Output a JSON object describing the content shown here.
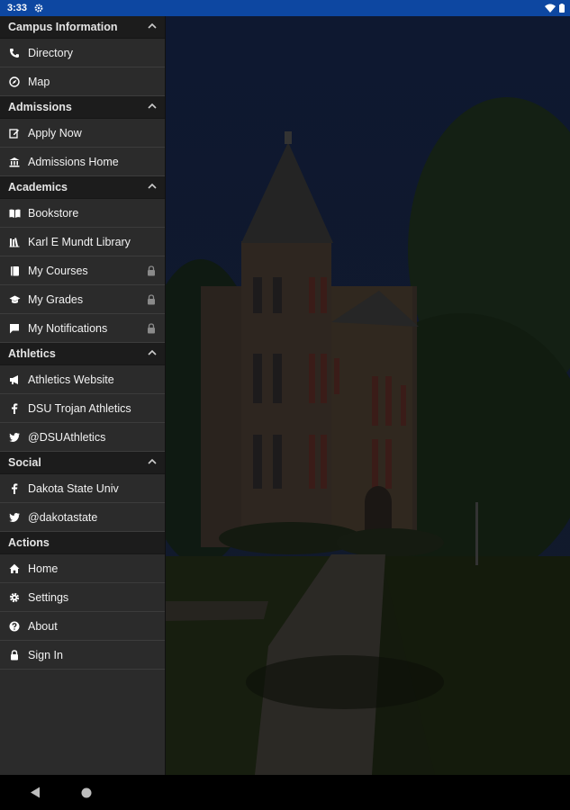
{
  "status_bar": {
    "time": "3:33"
  },
  "drawer": {
    "sections": [
      {
        "title": "Campus Information",
        "collapsible": true,
        "items": [
          {
            "label": "Directory",
            "icon": "phone-icon",
            "locked": false
          },
          {
            "label": "Map",
            "icon": "compass-icon",
            "locked": false
          }
        ]
      },
      {
        "title": "Admissions",
        "collapsible": true,
        "items": [
          {
            "label": "Apply Now",
            "icon": "edit-icon",
            "locked": false
          },
          {
            "label": "Admissions Home",
            "icon": "institution-icon",
            "locked": false
          }
        ]
      },
      {
        "title": "Academics",
        "collapsible": true,
        "items": [
          {
            "label": "Bookstore",
            "icon": "open-book-icon",
            "locked": false
          },
          {
            "label": "Karl E Mundt Library",
            "icon": "library-icon",
            "locked": false
          },
          {
            "label": "My Courses",
            "icon": "book-icon",
            "locked": true
          },
          {
            "label": "My Grades",
            "icon": "graduation-cap-icon",
            "locked": true
          },
          {
            "label": "My Notifications",
            "icon": "chat-bubble-icon",
            "locked": true
          }
        ]
      },
      {
        "title": "Athletics",
        "collapsible": true,
        "items": [
          {
            "label": "Athletics Website",
            "icon": "megaphone-icon",
            "locked": false
          },
          {
            "label": "DSU Trojan Athletics",
            "icon": "facebook-icon",
            "locked": false
          },
          {
            "label": "@DSUAthletics",
            "icon": "twitter-icon",
            "locked": false
          }
        ]
      },
      {
        "title": "Social",
        "collapsible": true,
        "items": [
          {
            "label": "Dakota State Univ",
            "icon": "facebook-icon",
            "locked": false
          },
          {
            "label": "@dakotastate",
            "icon": "twitter-icon",
            "locked": false
          }
        ]
      },
      {
        "title": "Actions",
        "collapsible": false,
        "items": [
          {
            "label": "Home",
            "icon": "home-icon",
            "locked": false
          },
          {
            "label": "Settings",
            "icon": "gear-icon",
            "locked": false
          },
          {
            "label": "About",
            "icon": "help-icon",
            "locked": false
          },
          {
            "label": "Sign In",
            "icon": "lock-icon",
            "locked": false
          }
        ]
      }
    ]
  }
}
